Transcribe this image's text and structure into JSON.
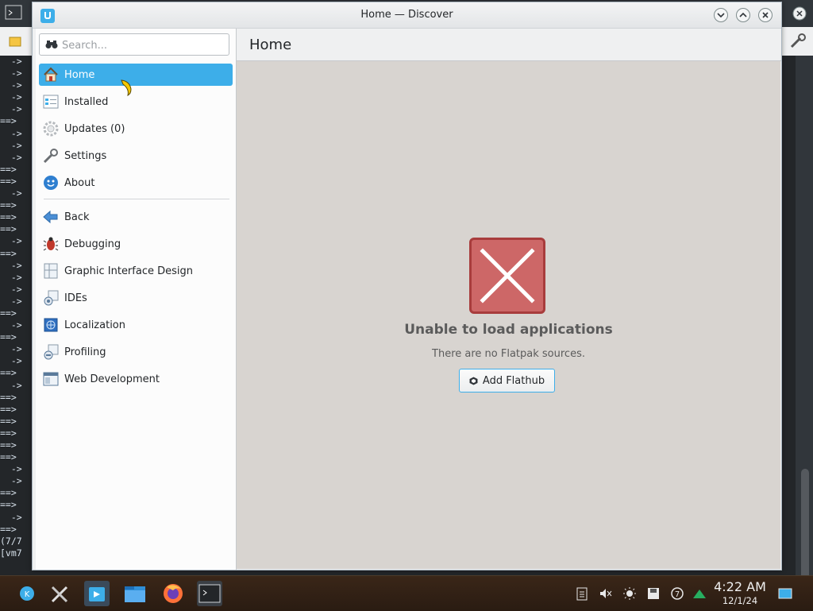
{
  "terminal": {
    "lines": [
      "  ->",
      "  ->",
      "  ->",
      "  ->",
      "  ->",
      "==> ",
      "  ->",
      "  ->",
      "  ->",
      "==> ",
      "==> ",
      "  ->",
      "==> ",
      "==> ",
      "==> ",
      "  ->",
      "==> ",
      "  ->",
      "  ->",
      "  ->",
      "  ->",
      "==> ",
      "  ->",
      "==> ",
      "  ->",
      "  ->",
      "==> ",
      "  ->",
      "==> ",
      "==> ",
      "==> ",
      "==> ",
      "==> ",
      "==> ",
      "  ->",
      "  ->",
      "==> ",
      "==> ",
      "  ->",
      "==> ",
      "(7/7",
      "[vm7"
    ]
  },
  "window": {
    "title": "Home — Discover"
  },
  "search": {
    "placeholder": "Search..."
  },
  "sidebar": {
    "top_items": [
      {
        "label": "Home",
        "icon": "home-icon",
        "active": true
      },
      {
        "label": "Installed",
        "icon": "installed-icon",
        "active": false
      },
      {
        "label": "Updates (0)",
        "icon": "updates-icon",
        "active": false
      },
      {
        "label": "Settings",
        "icon": "settings-icon",
        "active": false
      },
      {
        "label": "About",
        "icon": "about-icon",
        "active": false
      }
    ],
    "category_items": [
      {
        "label": "Back",
        "icon": "back-arrow-icon"
      },
      {
        "label": "Debugging",
        "icon": "bug-icon"
      },
      {
        "label": "Graphic Interface Design",
        "icon": "interface-design-icon"
      },
      {
        "label": "IDEs",
        "icon": "ide-icon"
      },
      {
        "label": "Localization",
        "icon": "localization-icon"
      },
      {
        "label": "Profiling",
        "icon": "profiling-icon"
      },
      {
        "label": "Web Development",
        "icon": "web-development-icon"
      }
    ]
  },
  "header": {
    "title": "Home"
  },
  "main": {
    "error_title": "Unable to load applications",
    "error_subtitle": "There are no Flatpak sources.",
    "add_button_label": "Add Flathub"
  },
  "taskbar": {
    "time": "4:22 AM",
    "date": "12/1/24",
    "apps": [
      "application-launcher-icon",
      "system-settings-icon",
      "discover-icon",
      "file-manager-icon",
      "firefox-icon",
      "terminal-icon"
    ],
    "tray": [
      "clipboard-icon",
      "volume-muted-icon",
      "brightness-icon",
      "storage-icon",
      "updates-tray-icon",
      "network-icon",
      "show-desktop-icon"
    ]
  },
  "colors": {
    "accent": "#3daee9",
    "error": "#cd6767"
  }
}
